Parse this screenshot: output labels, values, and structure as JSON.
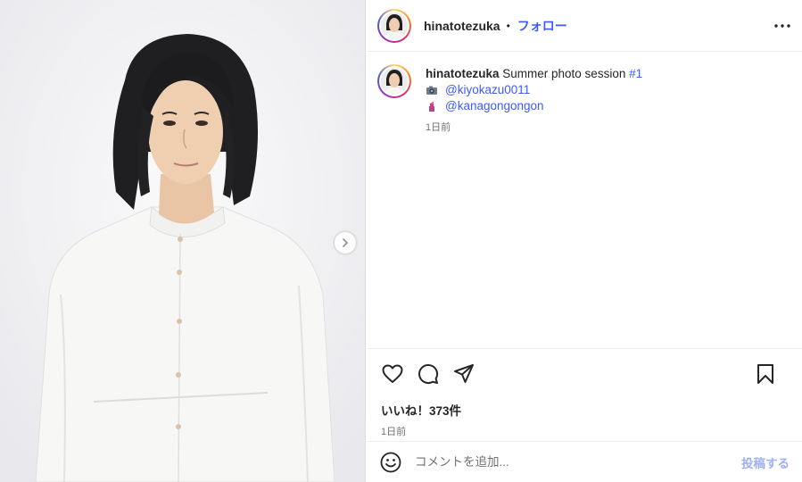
{
  "post": {
    "username": "hinatotezuka",
    "separator": "•",
    "follow_label": "フォロー",
    "more_icon": "more-dots-icon"
  },
  "caption": {
    "username": "hinatotezuka",
    "text": " Summer photo session ",
    "hashtag": "#1",
    "lines": [
      {
        "icon": "camera-emoji",
        "mention": "@kiyokazu0011"
      },
      {
        "icon": "lipstick-emoji",
        "mention": "@kanagongongon"
      }
    ],
    "time": "1日前"
  },
  "engagement": {
    "likes": "いいね！373件",
    "date": "1日前"
  },
  "comment": {
    "placeholder": "コメントを追加...",
    "post_label": "投稿する"
  },
  "colors": {
    "link": "#3d5afe",
    "muted": "#737373",
    "post_disabled": "#9fb0f5"
  }
}
